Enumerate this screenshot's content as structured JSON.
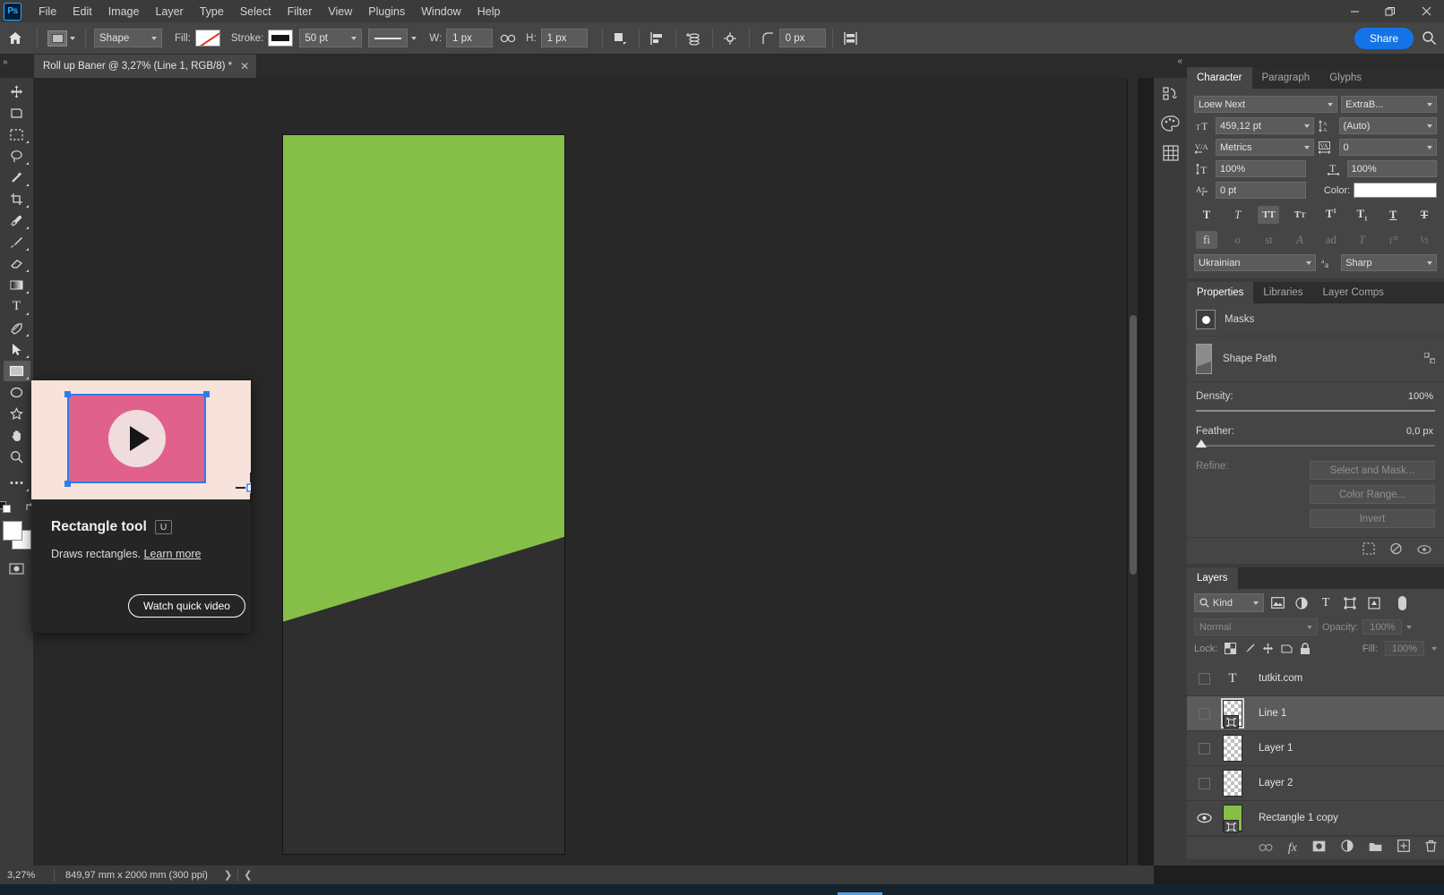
{
  "app": {
    "logo": "Ps",
    "menu": [
      "File",
      "Edit",
      "Image",
      "Layer",
      "Type",
      "Select",
      "Filter",
      "View",
      "Plugins",
      "Window",
      "Help"
    ],
    "window_controls": {
      "minimize": "—",
      "restore": "❐",
      "close": "✕"
    }
  },
  "options_bar": {
    "home_icon": "home-icon",
    "tool_preset_label": "",
    "mode": "Shape",
    "fill_label": "Fill:",
    "stroke_label": "Stroke:",
    "stroke_width": "50 pt",
    "stroke_style": "solid-line",
    "w_label": "W:",
    "w_value": "1 px",
    "link_icon": "link-icon",
    "h_label": "H:",
    "h_value": "1 px",
    "path_ops_icon": "path-operations-icon",
    "path_align_icon": "path-alignment-icon",
    "path_arrange_icon": "path-arrangement-icon",
    "gear_icon": "gear-icon",
    "radius_icon": "corner-radius-icon",
    "radius_value": "0 px",
    "align_edges_icon": "align-edges-icon",
    "share_label": "Share",
    "search_icon": "search-icon"
  },
  "document": {
    "tab_title": "Roll up Baner @ 3,27% (Line 1, RGB/8) *",
    "close_glyph": "✕",
    "collapse_glyph": "»"
  },
  "toolbar": {
    "tools": [
      {
        "name": "move-tool",
        "glyph": "✥",
        "has_submenu": false,
        "active": false
      },
      {
        "name": "artboard-tool",
        "glyph": "⬒",
        "has_submenu": false,
        "active": false
      },
      {
        "name": "marquee-tool",
        "glyph": "⬚",
        "has_submenu": true,
        "active": false
      },
      {
        "name": "lasso-tool",
        "glyph": "◯",
        "has_submenu": true,
        "active": false
      },
      {
        "name": "magic-wand-tool",
        "glyph": "✨",
        "has_submenu": true,
        "active": false
      },
      {
        "name": "crop-tool",
        "glyph": "⌗",
        "has_submenu": true,
        "active": false
      },
      {
        "name": "eyedropper-tool",
        "glyph": "✒",
        "has_submenu": true,
        "active": false
      },
      {
        "name": "brush-tool",
        "glyph": "✎",
        "has_submenu": true,
        "active": false
      },
      {
        "name": "eraser-tool",
        "glyph": "▱",
        "has_submenu": true,
        "active": false
      },
      {
        "name": "gradient-tool",
        "glyph": "▨",
        "has_submenu": true,
        "active": false
      },
      {
        "name": "type-tool",
        "glyph": "T",
        "has_submenu": true,
        "active": false
      },
      {
        "name": "pen-tool",
        "glyph": "☂",
        "has_submenu": true,
        "active": false
      },
      {
        "name": "path-selection-tool",
        "glyph": "➤",
        "has_submenu": true,
        "active": false
      },
      {
        "name": "rectangle-tool",
        "glyph": "▭",
        "has_submenu": true,
        "active": true
      },
      {
        "name": "ellipse-tool",
        "glyph": "◯",
        "has_submenu": false,
        "active": false
      },
      {
        "name": "custom-shape-tool",
        "glyph": "☆",
        "has_submenu": false,
        "active": false
      },
      {
        "name": "hand-tool",
        "glyph": "✋",
        "has_submenu": false,
        "active": false
      },
      {
        "name": "zoom-tool",
        "glyph": "⌕",
        "has_submenu": false,
        "active": false
      },
      {
        "name": "edit-toolbar-tool",
        "glyph": "⋯",
        "has_submenu": true,
        "active": false
      }
    ],
    "foreground_color": "#ffffff",
    "background_color": "#ffffff",
    "quick_mask_icon": "quick-mask-icon",
    "screen_mode_icon": "screen-mode-icon"
  },
  "canvas": {
    "artboard_bg": "#2f2f2f",
    "shape_color": "#86bf47",
    "workspace_bg": "#282828"
  },
  "status_bar": {
    "zoom": "3,27%",
    "dimensions": "849,97 mm x 2000 mm (300 ppi)",
    "next_glyph": "❯",
    "prev_glyph": "❮"
  },
  "tooltip": {
    "title": "Rectangle tool",
    "shortcut": "U",
    "description": "Draws rectangles.",
    "learn_more": "Learn more",
    "video_button": "Watch quick video",
    "media_bg": "#f7e3dc",
    "rect_color": "#e0628c"
  },
  "right_rail": {
    "icons": [
      {
        "name": "history-icon",
        "glyph": "↺"
      },
      {
        "name": "color-swatches-icon",
        "glyph": "◕"
      },
      {
        "name": "grid-panel-icon",
        "glyph": "▦"
      }
    ]
  },
  "character_panel": {
    "tabs": [
      {
        "label": "Character",
        "active": true
      },
      {
        "label": "Paragraph",
        "active": false
      },
      {
        "label": "Glyphs",
        "active": false
      }
    ],
    "font_family": "Loew Next",
    "font_style": "ExtraB...",
    "font_size": "459,12 pt",
    "leading": "(Auto)",
    "kerning": "Metrics",
    "tracking": "0",
    "vertical_scale": "100%",
    "horizontal_scale": "100%",
    "baseline_shift": "0 pt",
    "color_label": "Color:",
    "color_value": "#ffffff",
    "style_buttons": [
      {
        "name": "faux-bold",
        "glyph": "T",
        "active": false,
        "disabled": false
      },
      {
        "name": "faux-italic",
        "glyph": "T",
        "active": false,
        "disabled": false
      },
      {
        "name": "all-caps",
        "glyph": "TT",
        "active": true,
        "disabled": false
      },
      {
        "name": "small-caps",
        "glyph": "Tт",
        "active": false,
        "disabled": false
      },
      {
        "name": "superscript",
        "glyph": "T¹",
        "active": false,
        "disabled": false
      },
      {
        "name": "subscript",
        "glyph": "T₁",
        "active": false,
        "disabled": false
      },
      {
        "name": "underline",
        "glyph": "T",
        "active": false,
        "disabled": false
      },
      {
        "name": "strikethrough",
        "glyph": "Ŧ",
        "active": false,
        "disabled": false
      }
    ],
    "opentype_buttons": [
      {
        "name": "standard-ligatures",
        "glyph": "fi",
        "active": true,
        "disabled": false
      },
      {
        "name": "contextual-alternates",
        "glyph": "œ",
        "active": false,
        "disabled": true
      },
      {
        "name": "discretionary-ligatures",
        "glyph": "st",
        "active": false,
        "disabled": true
      },
      {
        "name": "swash",
        "glyph": "𝒜",
        "active": false,
        "disabled": true
      },
      {
        "name": "oldstyle",
        "glyph": "ad",
        "active": false,
        "disabled": true
      },
      {
        "name": "stylistic-alternates",
        "glyph": "T",
        "active": false,
        "disabled": true
      },
      {
        "name": "ordinals",
        "glyph": "1st",
        "active": false,
        "disabled": true
      },
      {
        "name": "fractions",
        "glyph": "½",
        "active": false,
        "disabled": true
      }
    ],
    "language": "Ukrainian",
    "antialias_icon": "antialias-icon",
    "antialias": "Sharp"
  },
  "properties_panel": {
    "tabs": [
      {
        "label": "Properties",
        "active": true
      },
      {
        "label": "Libraries",
        "active": false
      },
      {
        "label": "Layer Comps",
        "active": false
      }
    ],
    "masks_label": "Masks",
    "shape_path_label": "Shape Path",
    "density_label": "Density:",
    "density_value": "100%",
    "feather_label": "Feather:",
    "feather_value": "0,0 px",
    "refine_label": "Refine:",
    "buttons": [
      "Select and Mask...",
      "Color Range...",
      "Invert"
    ],
    "footer_icons": [
      {
        "name": "load-selection-icon",
        "glyph": "⬚"
      },
      {
        "name": "apply-mask-icon",
        "glyph": "⥁"
      },
      {
        "name": "toggle-mask-icon",
        "glyph": "◉"
      },
      {
        "name": "delete-mask-icon",
        "glyph": "🗑"
      }
    ]
  },
  "layers_panel": {
    "tabs": [
      {
        "label": "Layers",
        "active": true
      }
    ],
    "filter_kind": "Kind",
    "filter_icons": [
      {
        "name": "filter-pixel-icon",
        "glyph": "⛰"
      },
      {
        "name": "filter-adjustment-icon",
        "glyph": "◐"
      },
      {
        "name": "filter-type-icon",
        "glyph": "T"
      },
      {
        "name": "filter-shape-icon",
        "glyph": "⬚"
      },
      {
        "name": "filter-smart-object-icon",
        "glyph": "⛁"
      },
      {
        "name": "filter-toggle-icon",
        "glyph": "●"
      }
    ],
    "blend_mode": "Normal",
    "opacity_label": "Opacity:",
    "opacity_value": "100%",
    "lock_label": "Lock:",
    "lock_icons": [
      {
        "name": "lock-transparent-pixels-icon",
        "glyph": "▦"
      },
      {
        "name": "lock-image-pixels-icon",
        "glyph": "✎"
      },
      {
        "name": "lock-position-icon",
        "glyph": "✥"
      },
      {
        "name": "lock-artboard-nesting-icon",
        "glyph": "⌧"
      },
      {
        "name": "lock-all-icon",
        "glyph": "🔒"
      }
    ],
    "fill_label": "Fill:",
    "fill_value": "100%",
    "layers": [
      {
        "name": "tutkit.com",
        "type": "text",
        "visible": false,
        "selected": false,
        "has_vector_mask": false
      },
      {
        "name": "Line 1",
        "type": "shape",
        "visible": false,
        "selected": true,
        "has_vector_mask": true
      },
      {
        "name": "Layer 1",
        "type": "pixel",
        "visible": false,
        "selected": false,
        "has_vector_mask": false
      },
      {
        "name": "Layer 2",
        "type": "pixel",
        "visible": false,
        "selected": false,
        "has_vector_mask": false
      },
      {
        "name": "Rectangle 1 copy",
        "type": "shape-filled",
        "visible": true,
        "selected": false,
        "has_vector_mask": true
      }
    ],
    "footer_icons": [
      {
        "name": "link-layers-icon",
        "glyph": "⚭"
      },
      {
        "name": "layer-style-icon",
        "glyph": "fx"
      },
      {
        "name": "add-mask-icon",
        "glyph": "◉"
      },
      {
        "name": "adjustment-layer-icon",
        "glyph": "◐"
      },
      {
        "name": "new-group-icon",
        "glyph": "▰"
      },
      {
        "name": "new-layer-icon",
        "glyph": "⊞"
      },
      {
        "name": "delete-layer-icon",
        "glyph": "🗑"
      }
    ]
  }
}
